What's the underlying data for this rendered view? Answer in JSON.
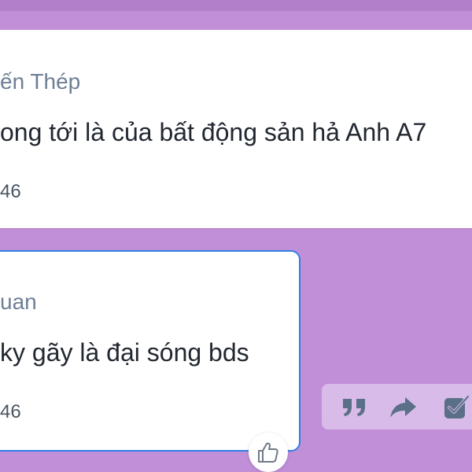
{
  "messages": [
    {
      "sender": "ến Thép",
      "text": "ong tới là của bất động sản hả Anh A7",
      "time": "46"
    },
    {
      "sender": "uan",
      "text": "ky gãy là đại sóng bds",
      "time": "46"
    }
  ],
  "actions": {
    "quote_icon": "quote-icon",
    "forward_icon": "forward-icon",
    "select_icon": "checkbox-icon"
  },
  "reaction": {
    "icon": "thumbs-up-icon"
  },
  "colors": {
    "chat_background": "#c18fd8",
    "selected_border": "#2f7fe6",
    "action_bar": "#d8bbe8",
    "icon": "#5a6f88"
  }
}
